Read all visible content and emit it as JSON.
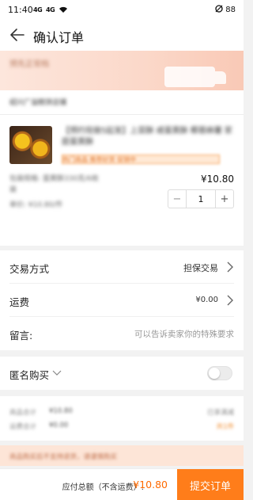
{
  "status_bar": {
    "time": "11:40",
    "signal_1": "4G",
    "signal_2": "4G",
    "battery": "88"
  },
  "nav": {
    "title": "确认订单"
  },
  "delivery": {
    "text": "预先正常档"
  },
  "shop": {
    "name": "绍兴广溢糕饼店铺"
  },
  "product": {
    "title": "【预约现做5起发】上菜酥 咸蛋黄酥 椰蓉麻薯 家庭蛋黄酥",
    "tag": "热门商品 推荐好货 促销中",
    "spec": "包装规格: 蛋黄酥330克/6枚装",
    "unit": "单价: ¥10.80/件",
    "price": "¥10.80",
    "quantity": "1",
    "minus_label": "−",
    "plus_label": "+"
  },
  "options": {
    "trade_label": "交易方式",
    "trade_value": "担保交易",
    "shipping_label": "运费",
    "shipping_value": "¥0.00",
    "message_label": "留言:",
    "message_placeholder": "可以告诉卖家你的特殊要求"
  },
  "anonymous": {
    "label": "匿名购买",
    "enabled": false
  },
  "summary": {
    "line1_label": "商品合计",
    "line1_value": "¥10.80",
    "line1_right": "已享满减",
    "line2_label": "运费合计",
    "line2_value": "¥0.00",
    "line2_right": "共1件"
  },
  "notice": {
    "text": "商品购买后不支持退货，请谨慎购买"
  },
  "bottom": {
    "total_label": "应付总额（不含运费）:",
    "total_value": "¥10.80",
    "submit_label": "提交订单"
  },
  "colors": {
    "accent": "#ff7d1a",
    "price": "#ff6a00",
    "banner": "#fbd8c9"
  }
}
